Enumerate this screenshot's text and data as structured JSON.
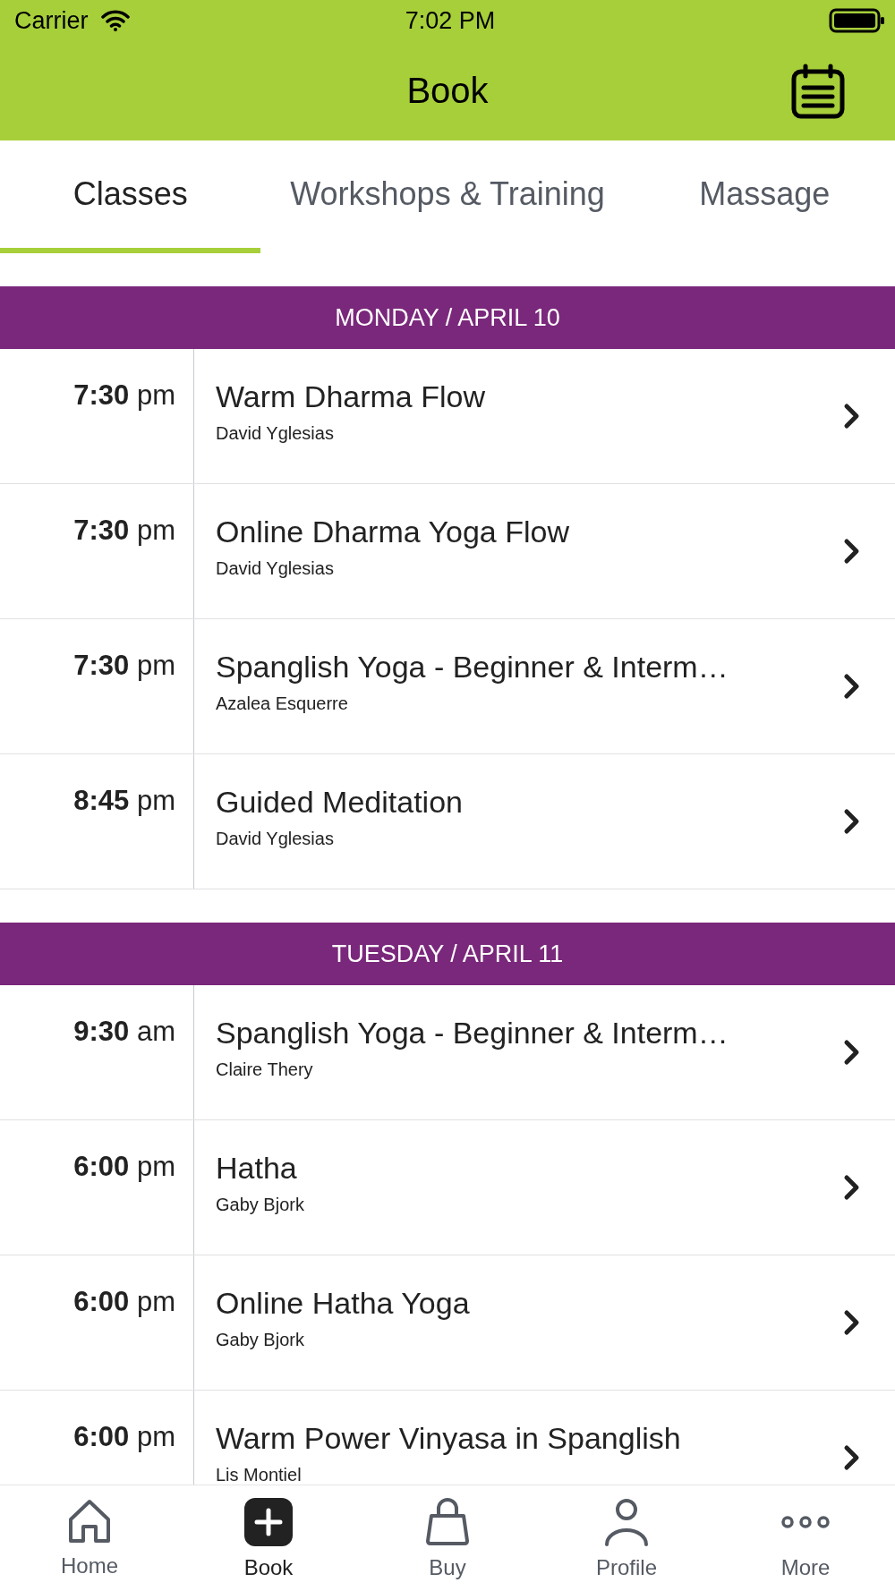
{
  "status_bar": {
    "carrier": "Carrier",
    "time": "7:02 PM"
  },
  "header": {
    "title": "Book"
  },
  "tabs": [
    {
      "label": "Classes",
      "selected": true
    },
    {
      "label": "Workshops & Training",
      "selected": false
    },
    {
      "label": "Massage",
      "selected": false
    }
  ],
  "days": [
    {
      "heading": "MONDAY / APRIL 10",
      "classes": [
        {
          "time": "**7:30** pm",
          "title": "Warm Dharma Flow",
          "teacher": "David Yglesias"
        },
        {
          "time": "**7:30** pm",
          "title": "Online Dharma Yoga Flow",
          "teacher": "David Yglesias"
        },
        {
          "time": "**7:30** pm",
          "title": "Spanglish Yoga - Beginner & Interm…",
          "teacher": "Azalea Esquerre"
        },
        {
          "time": "**8:45** pm",
          "title": "Guided Meditation",
          "teacher": "David Yglesias"
        }
      ]
    },
    {
      "heading": "TUESDAY / APRIL 11",
      "classes": [
        {
          "time": "**9:30** am",
          "title": "Spanglish Yoga - Beginner & Interm…",
          "teacher": "Claire Thery"
        },
        {
          "time": "**6:00** pm",
          "title": "Hatha",
          "teacher": "Gaby Bjork"
        },
        {
          "time": "**6:00** pm",
          "title": "Online Hatha Yoga",
          "teacher": "Gaby Bjork"
        },
        {
          "time": "**6:00** pm",
          "title": "Warm Power Vinyasa in Spanglish",
          "teacher": "Lis Montiel"
        }
      ]
    }
  ],
  "nav": [
    {
      "kind": "home",
      "label": "Home",
      "selected": false
    },
    {
      "kind": "book",
      "label": "Book",
      "selected": true
    },
    {
      "kind": "buy",
      "label": "Buy",
      "selected": false
    },
    {
      "kind": "profile",
      "label": "Profile",
      "selected": false
    },
    {
      "kind": "more",
      "label": "More",
      "selected": false
    }
  ]
}
